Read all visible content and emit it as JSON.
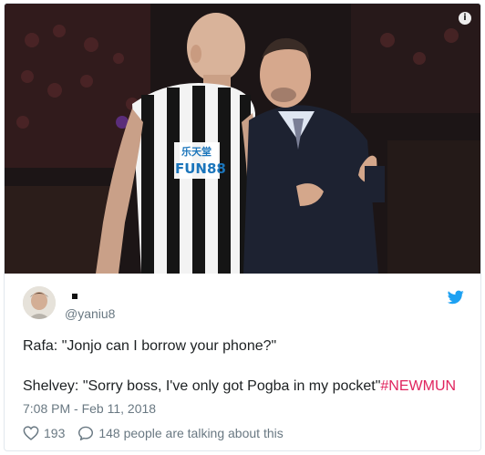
{
  "media": {
    "shirt_sponsor": "FUN88",
    "shirt_sponsor_chinese": "乐天堂",
    "colors": {
      "background": "#1a1414",
      "shirt_stripe": "#111111",
      "suit": "#1d2231"
    }
  },
  "info_icon": "i",
  "tweet": {
    "display_name": "",
    "handle": "@yaniu8",
    "line1": "Rafa: \"Jonjo can I borrow your phone?\"",
    "line2": "Shelvey: \"Sorry boss, I've only got Pogba in my pocket\"",
    "hashtag": "#NEWMUN",
    "timestamp": "7:08 PM - Feb 11, 2018",
    "likes": "193",
    "talking": "148 people are talking about this"
  },
  "icons": {
    "brand": "twitter-bird-icon",
    "like": "heart-icon",
    "reply": "speech-bubble-icon",
    "info": "info-icon"
  },
  "colors": {
    "twitter_blue": "#1da1f2",
    "hashtag": "#e0245e",
    "meta_text": "#697882",
    "body_text": "#1c2022",
    "border": "#e1e8ed"
  }
}
